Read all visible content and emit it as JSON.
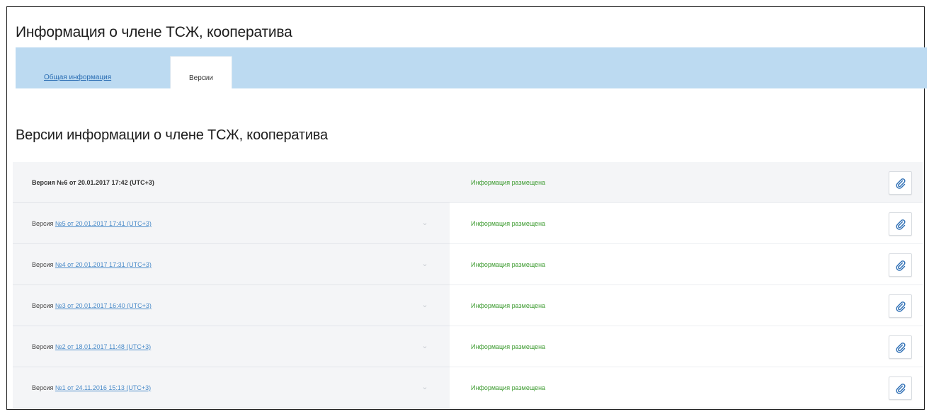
{
  "page": {
    "title": "Информация о члене ТСЖ, кооператива"
  },
  "tabs": {
    "general": "Общая информация",
    "versions": "Версии"
  },
  "section": {
    "title": "Версии информации о члене ТСЖ, кооператива"
  },
  "versions": [
    {
      "prefix": "Версия",
      "label": "№6 от 20.01.2017 17:42 (UTC+3)",
      "status": "Информация размещена",
      "current": true,
      "icons": {
        "attach": "paperclip-icon"
      }
    },
    {
      "prefix": "Версия",
      "label": "№5 от 20.01.2017 17:41 (UTC+3)",
      "status": "Информация размещена",
      "current": false,
      "icons": {
        "chevron": "chevron-down-icon",
        "attach": "paperclip-icon"
      }
    },
    {
      "prefix": "Версия",
      "label": "№4 от 20.01.2017 17:31 (UTC+3)",
      "status": "Информация размещена",
      "current": false,
      "icons": {
        "chevron": "chevron-down-icon",
        "attach": "paperclip-icon"
      }
    },
    {
      "prefix": "Версия",
      "label": "№3 от 20.01.2017 16:40 (UTC+3)",
      "status": "Информация размещена",
      "current": false,
      "icons": {
        "chevron": "chevron-down-icon",
        "attach": "paperclip-icon"
      }
    },
    {
      "prefix": "Версия",
      "label": "№2 от 18.01.2017 11:48 (UTC+3)",
      "status": "Информация размещена",
      "current": false,
      "icons": {
        "chevron": "chevron-down-icon",
        "attach": "paperclip-icon"
      }
    },
    {
      "prefix": "Версия",
      "label": "№1 от 24.11.2016 15:13 (UTC+3)",
      "status": "Информация размещена",
      "current": false,
      "icons": {
        "chevron": "chevron-down-icon",
        "attach": "paperclip-icon"
      }
    }
  ],
  "colors": {
    "tabbar_bg": "#bcdaf1",
    "link": "#4a8bc9",
    "status_green": "#3b9a2e",
    "row_bg": "#f4f5f7"
  }
}
